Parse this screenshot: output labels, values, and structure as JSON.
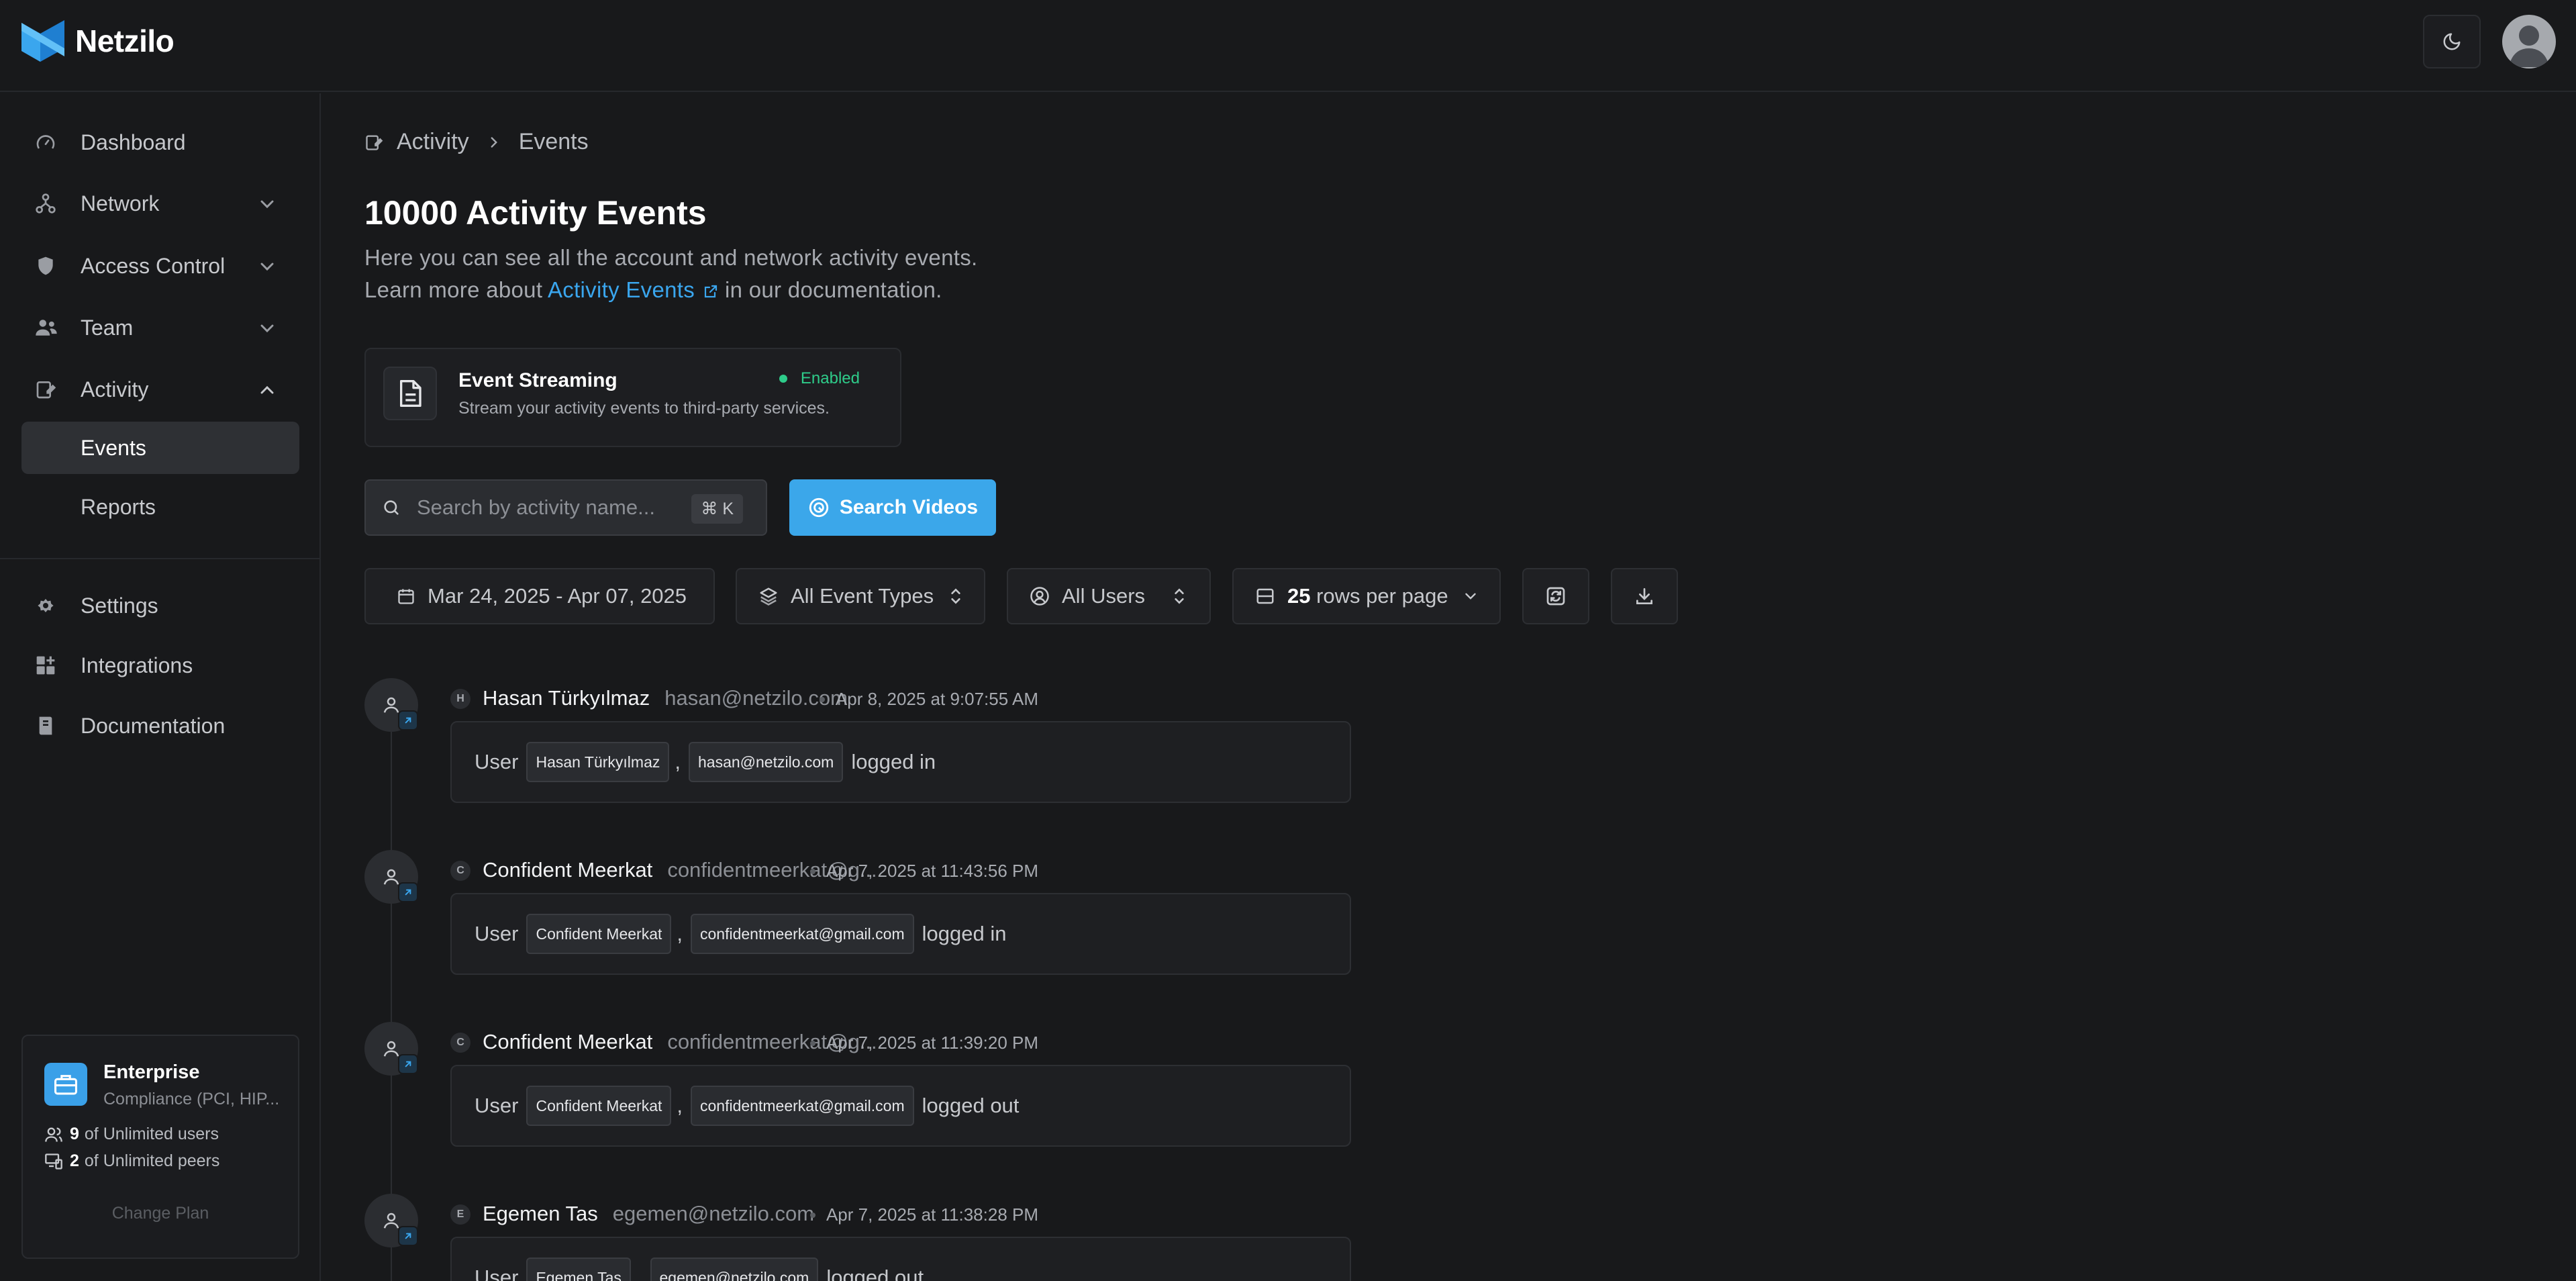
{
  "app": {
    "logo_text": "Netzilo"
  },
  "sidebar": {
    "items": [
      {
        "label": "Dashboard",
        "icon": "gauge-icon"
      },
      {
        "label": "Network",
        "icon": "network-icon"
      },
      {
        "label": "Access Control",
        "icon": "shield-icon"
      },
      {
        "label": "Team",
        "icon": "users-icon"
      },
      {
        "label": "Activity",
        "icon": "activity-icon"
      },
      {
        "label": "Settings",
        "icon": "gear-icon"
      },
      {
        "label": "Integrations",
        "icon": "integrations-icon"
      },
      {
        "label": "Documentation",
        "icon": "book-icon"
      }
    ],
    "activity_sub": [
      {
        "label": "Events"
      },
      {
        "label": "Reports"
      }
    ],
    "plan": {
      "name": "Enterprise",
      "subtitle": "Compliance (PCI, HIP...",
      "users_count": "9",
      "users_text": "of Unlimited users",
      "peers_count": "2",
      "peers_text": "of Unlimited peers",
      "change_label": "Change Plan"
    }
  },
  "breadcrumb": {
    "parent": "Activity",
    "current": "Events"
  },
  "page": {
    "title": "10000 Activity Events",
    "desc_line1": "Here you can see all the account and network activity events.",
    "desc_prefix": "Learn more about",
    "desc_link": "Activity Events",
    "desc_suffix": "in our documentation."
  },
  "streaming": {
    "title": "Event Streaming",
    "desc": "Stream your activity events to third-party services.",
    "status": "Enabled",
    "status_color": "#2ecc8a"
  },
  "search": {
    "placeholder": "Search by activity name...",
    "shortcut": "⌘ K",
    "videos_label": "Search Videos"
  },
  "filters": {
    "date_range": "Mar 24, 2025 - Apr 07, 2025",
    "event_types": "All Event Types",
    "users": "All Users",
    "rows_count": "25",
    "rows_suffix": "rows per page"
  },
  "events": [
    {
      "initial": "H",
      "name": "Hasan Türkyılmaz",
      "email": "hasan@netzilo.com",
      "time": "Apr 8, 2025 at 9:07:55 AM",
      "prefix": "User",
      "chip_name": "Hasan Türkyılmaz",
      "chip_email": "hasan@netzilo.com",
      "action": "logged in"
    },
    {
      "initial": "C",
      "name": "Confident Meerkat",
      "email": "confidentmeerkat@g...",
      "time": "Apr 7, 2025 at 11:43:56 PM",
      "prefix": "User",
      "chip_name": "Confident Meerkat",
      "chip_email": "confidentmeerkat@gmail.com",
      "action": "logged in"
    },
    {
      "initial": "C",
      "name": "Confident Meerkat",
      "email": "confidentmeerkat@g...",
      "time": "Apr 7, 2025 at 11:39:20 PM",
      "prefix": "User",
      "chip_name": "Confident Meerkat",
      "chip_email": "confidentmeerkat@gmail.com",
      "action": "logged out"
    },
    {
      "initial": "E",
      "name": "Egemen Tas",
      "email": "egemen@netzilo.com",
      "time": "Apr 7, 2025 at 11:38:28 PM",
      "prefix": "User",
      "chip_name": "Egemen Tas",
      "chip_email": "egemen@netzilo.com",
      "action": "logged out"
    }
  ],
  "colors": {
    "accent": "#3ba7ea",
    "background": "#18191b"
  }
}
